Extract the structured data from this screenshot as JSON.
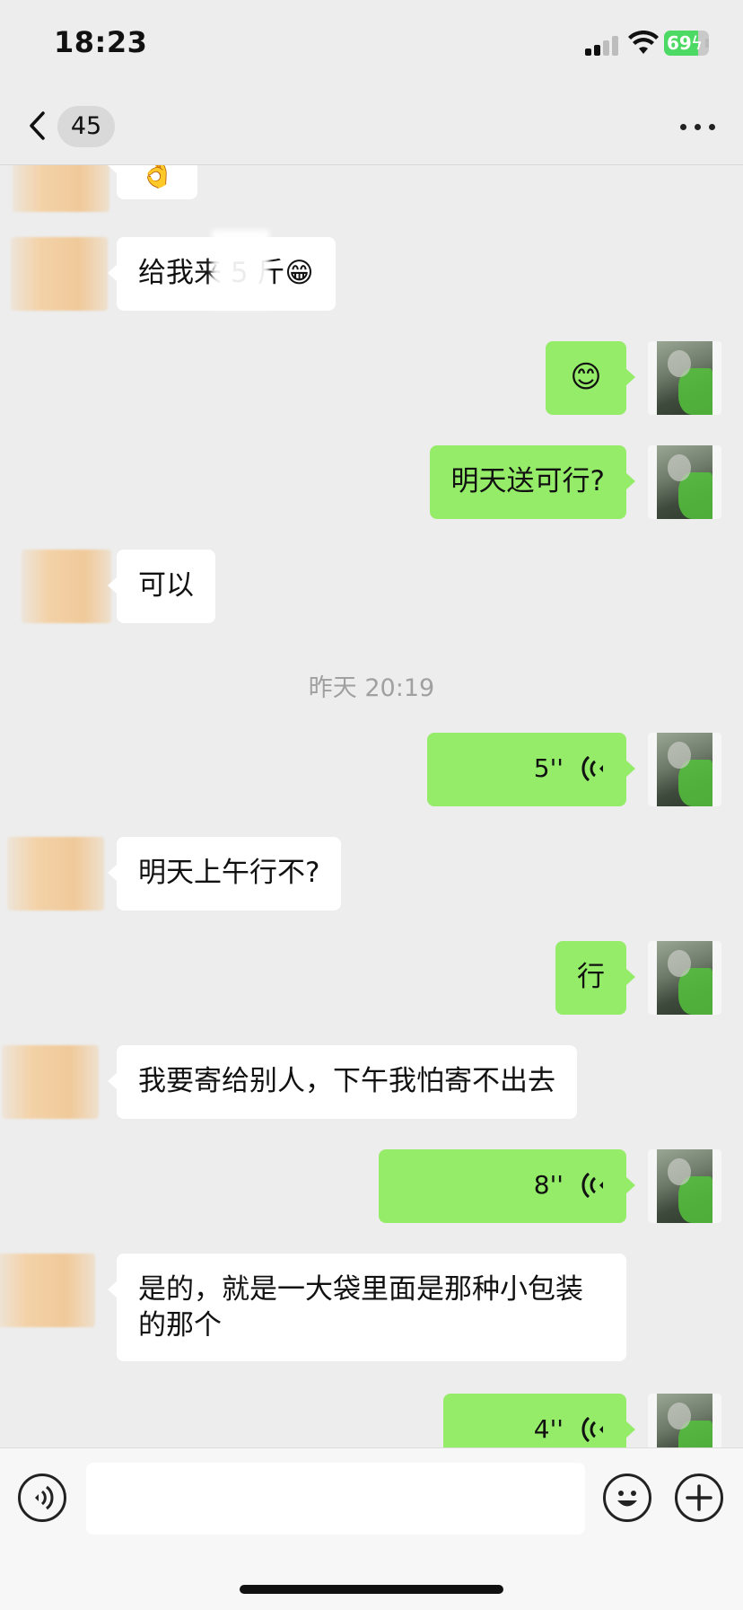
{
  "status_bar": {
    "time": "18:23",
    "battery": "69"
  },
  "nav": {
    "unread_count": "45"
  },
  "messages": [
    {
      "side": "in",
      "text": "👌"
    },
    {
      "side": "in",
      "text": "给我来 5 斤😁"
    },
    {
      "side": "out",
      "text": "😊"
    },
    {
      "side": "out",
      "text": "明天送可行?"
    },
    {
      "side": "in",
      "text": "可以"
    },
    {
      "side": "out",
      "type": "voice",
      "duration": "5''"
    },
    {
      "side": "in",
      "text": "明天上午行不?"
    },
    {
      "side": "out",
      "text": "行"
    },
    {
      "side": "in",
      "text": "我要寄给别人，下午我怕寄不出去"
    },
    {
      "side": "out",
      "type": "voice",
      "duration": "8''"
    },
    {
      "side": "in",
      "text": "是的，就是一大袋里面是那种小包装的那个"
    },
    {
      "side": "out",
      "type": "voice",
      "duration": "4''"
    }
  ],
  "timestamp": "昨天 20:19",
  "input": {
    "value": "",
    "placeholder": ""
  },
  "colors": {
    "background": "#ededed",
    "outgoing_bubble": "#95ec69",
    "incoming_bubble": "#ffffff",
    "battery_green": "#4cd964"
  },
  "icons": [
    "back-chevron-icon",
    "more-icon",
    "voice-input-icon",
    "emoji-icon",
    "plus-icon",
    "voice-wave-icon",
    "signal-icon",
    "wifi-icon",
    "battery-icon"
  ]
}
